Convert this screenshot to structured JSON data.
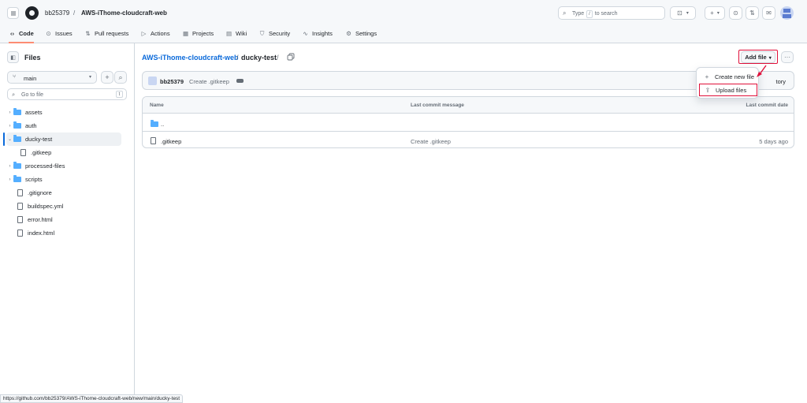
{
  "header": {
    "owner": "bb25379",
    "separator": "/",
    "repo": "AWS-iThome-cloudcraft-web",
    "search": {
      "prefix": "Type",
      "key": "/",
      "suffix": "to search"
    }
  },
  "tabs": [
    {
      "label": "Code",
      "icon": "code-icon"
    },
    {
      "label": "Issues",
      "icon": "issue-icon"
    },
    {
      "label": "Pull requests",
      "icon": "pull-request-icon"
    },
    {
      "label": "Actions",
      "icon": "play-icon"
    },
    {
      "label": "Projects",
      "icon": "table-icon"
    },
    {
      "label": "Wiki",
      "icon": "book-icon"
    },
    {
      "label": "Security",
      "icon": "shield-icon"
    },
    {
      "label": "Insights",
      "icon": "graph-icon"
    },
    {
      "label": "Settings",
      "icon": "gear-icon"
    }
  ],
  "sidebar": {
    "title": "Files",
    "branch": "main",
    "goto_placeholder": "Go to file",
    "goto_key": "t",
    "tree": [
      {
        "label": "assets",
        "type": "folder"
      },
      {
        "label": "auth",
        "type": "folder"
      },
      {
        "label": "ducky-test",
        "type": "folder",
        "expanded": true,
        "selected": true
      },
      {
        "label": ".gitkeep",
        "type": "file",
        "child": true
      },
      {
        "label": "processed-files",
        "type": "folder"
      },
      {
        "label": "scripts",
        "type": "folder"
      },
      {
        "label": ".gitignore",
        "type": "file"
      },
      {
        "label": "buildspec.yml",
        "type": "file"
      },
      {
        "label": "error.html",
        "type": "file"
      },
      {
        "label": "index.html",
        "type": "file"
      }
    ]
  },
  "main": {
    "breadcrumb_repo": "AWS-iThome-cloudcraft-web",
    "breadcrumb_folder": "ducky-test",
    "breadcrumb_sep": "/",
    "add_file_label": "Add file",
    "commit": {
      "user": "bb25379",
      "message": "Create .gitkeep",
      "history_label": "tory"
    },
    "table": {
      "columns": {
        "name": "Name",
        "message": "Last commit message",
        "date": "Last commit date"
      },
      "rows": [
        {
          "name": "..",
          "message": "",
          "date": "",
          "type": "folder"
        },
        {
          "name": ".gitkeep",
          "message": "Create .gitkeep",
          "date": "5 days ago",
          "type": "file"
        }
      ]
    }
  },
  "menu": {
    "items": [
      {
        "label": "Create new file",
        "icon": "plus-icon"
      },
      {
        "label": "Upload files",
        "icon": "upload-icon",
        "highlighted": true
      }
    ]
  },
  "statusbar": {
    "url": "https://github.com/bb25379/AWS-iThome-cloudcraft-web/new/main/ducky-test"
  },
  "colors": {
    "accent": "#0969da",
    "annotation": "#e0103a",
    "active_tab": "#fd8c73",
    "folder": "#54aeff"
  }
}
